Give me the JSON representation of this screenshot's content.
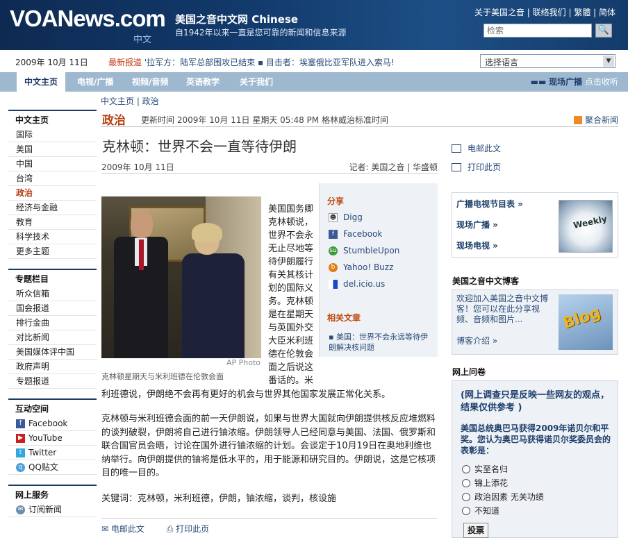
{
  "header": {
    "logo_main": "VOANews.com",
    "logo_sub": "中文",
    "site_title": "美国之音中文网 Chinese",
    "site_subtitle": "自1942年以来一直是您可靠的新闻和信息来源",
    "top_links": "关于美国之音 | 联络我们 | 繁體 | 简体",
    "search_placeholder": "检索",
    "search_button": "🔍"
  },
  "subbar": {
    "date": "2009年 10月 11日",
    "ticker_label": "最新报道",
    "ticker_text": "'拉军方：陆军总部围攻已结束 ▪ 目击者：埃塞俄比亚军队进入索马!",
    "language_select": "选择语言",
    "language_arrow": "▼"
  },
  "nav": {
    "tabs": [
      "中文主页",
      "电视/广播",
      "视频/音频",
      "英语教学",
      "关于我们"
    ],
    "radio_label": "现场广播",
    "radio_hint": "点击收听"
  },
  "breadcrumb": "中文主页 | 政治",
  "sidebar": {
    "sec1_title": "中文主页",
    "sec1_items": [
      "国际",
      "美国",
      "中国",
      "台湾",
      "政治",
      "经济与金融",
      "教育",
      "科学技术",
      "更多主题"
    ],
    "sec2_title": "专题栏目",
    "sec2_items": [
      "听众信箱",
      "国会报道",
      "排行金曲",
      "对比新闻",
      "美国媒体评中国",
      "政府声明",
      "专题报道"
    ],
    "sec3_title": "互动空间",
    "sec3_items": [
      "Facebook",
      "YouTube",
      "Twitter",
      "QQ贴文"
    ],
    "sec4_title": "网上服务",
    "sec4_items": [
      "订阅新闻"
    ]
  },
  "section": {
    "name": "政治",
    "updated": "更新时间 2009年 10月 11日 星期天 05:48 PM 格林威治标准时间",
    "rss": "聚合新闻"
  },
  "article": {
    "headline": "克林顿：世界不会一直等待伊朗",
    "date": "2009年 10月 11日",
    "author": "记者: 美国之音 | 华盛顿",
    "photo_credit": "AP Photo",
    "photo_caption": "克林顿星期天与米利班德在伦敦会面",
    "para1_col": "美国国务卿克林顿说，世界不会永无止尽地等待伊朗履行有关其核计划的国际义务。克林顿是在星期天与英国外交大臣米利班德在伦敦会面之后说这番话的。米",
    "para1_rest": "利班德说，伊朗绝不会再有更好的机会与世界其他国家发展正常化关系。",
    "para2": "克林顿与米利班德会面的前一天伊朗说，如果与世界大国就向伊朗提供核反应堆燃料的谈判破裂，伊朗将自己进行铀浓缩。伊朗领导人已经同意与美国、法国、俄罗斯和联合国官员会晤，讨论在国外进行铀浓缩的计划。会谈定于10月19日在奥地利维也纳举行。向伊朗提供的铀将是低水平的，用于能源和研究目的。伊朗说，这是它核项目的唯一目的。",
    "keywords": "关键词：克林顿，米利班德，伊朗，铀浓缩，谈判，核设施",
    "email": "电邮此文",
    "print": "打印此页"
  },
  "share": {
    "title": "分享",
    "items": [
      "Digg",
      "Facebook",
      "StumbleUpon",
      "Yahoo! Buzz",
      "del.icio.us"
    ],
    "related_title": "相关文章",
    "related_item": "美国：世界不会永远等待伊朗解决核问题"
  },
  "right": {
    "email": "电邮此文",
    "print": "打印此页",
    "tv_items": [
      "广播电视节目表 »",
      "现场广播 »",
      "现场电视 »"
    ],
    "tv_image_text": "Weekly",
    "blog_title": "美国之音中文博客",
    "blog_text": "欢迎加入美国之音中文博客！您可以在此分享视频、音频和图片...",
    "blog_link": "博客介绍 »",
    "blog_image_text": "Blog",
    "poll_title": "网上问卷",
    "poll_note": "(网上调查只是反映一些网友的观点，结果仅供参考 )",
    "poll_question": "美国总统奥巴马获得2009年诺贝尔和平奖。您认为奥巴马获得诺贝尔奖委员会的表彰是：",
    "poll_options": [
      "实至名归",
      "锦上添花",
      "政治因素 无关功绩",
      "不知道"
    ],
    "vote_button": "投票"
  },
  "colors": {
    "header_bg": "#123a6c",
    "nav_bg": "#9eb8d0",
    "section_accent": "#b8400f",
    "link": "#2a4c7a"
  }
}
